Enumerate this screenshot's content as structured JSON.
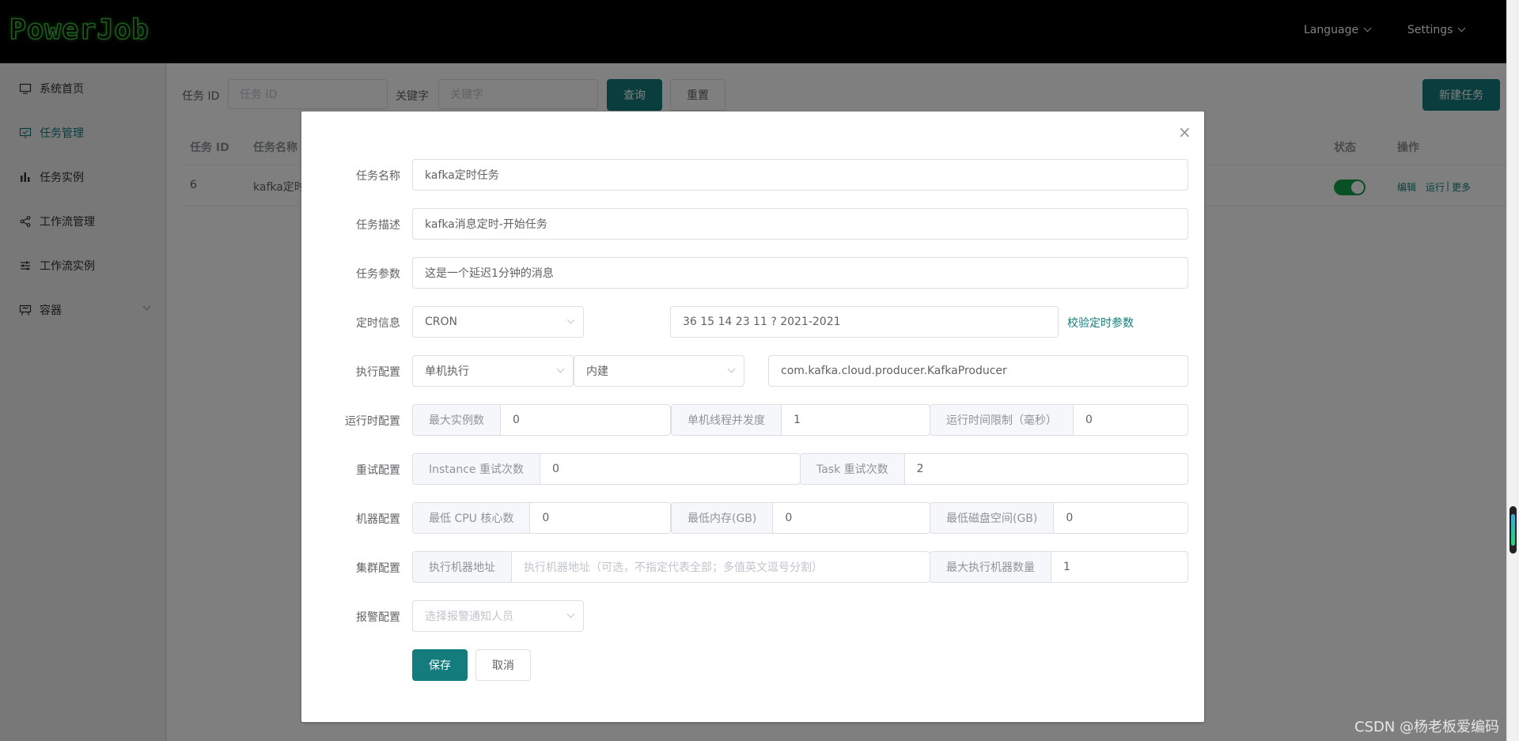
{
  "app": {
    "logo": "PowerJob",
    "menu_language": "Language",
    "menu_settings": "Settings"
  },
  "sidebar": {
    "items": [
      {
        "label": "系统首页",
        "icon": "monitor-icon"
      },
      {
        "label": "任务管理",
        "icon": "task-icon",
        "active": true
      },
      {
        "label": "任务实例",
        "icon": "bar-chart-icon"
      },
      {
        "label": "工作流管理",
        "icon": "share-icon"
      },
      {
        "label": "工作流实例",
        "icon": "sliders-icon"
      },
      {
        "label": "容器",
        "icon": "easel-icon",
        "expandable": true
      }
    ]
  },
  "search": {
    "id_label": "任务 ID",
    "id_placeholder": "任务 ID",
    "keyword_label": "关键字",
    "keyword_placeholder": "关键字",
    "query_button": "查询",
    "reset_button": "重置",
    "new_button": "新建任务"
  },
  "table": {
    "headers": {
      "id": "任务 ID",
      "name": "任务名称",
      "status": "状态",
      "ops": "操作"
    },
    "rows": [
      {
        "id": "6",
        "name": "kafka定时",
        "enabled": true,
        "op_edit": "编辑",
        "op_run": "运行",
        "op_sep": "|",
        "op_more": "更多"
      }
    ]
  },
  "dialog": {
    "close_icon": "×",
    "name_label": "任务名称",
    "name_value": "kafka定时任务",
    "desc_label": "任务描述",
    "desc_value": "kafka消息定时-开始任务",
    "params_label": "任务参数",
    "params_value": "这是一个延迟1分钟的消息",
    "timing_label": "定时信息",
    "timing_type": "CRON",
    "timing_expr": "36 15 14 23 11 ? 2021-2021",
    "validate_link": "校验定时参数",
    "exec_label": "执行配置",
    "exec_type": "单机执行",
    "processor_type": "内建",
    "processor_info": "com.kafka.cloud.producer.KafkaProducer",
    "runtime_label": "运行时配置",
    "max_instance_label": "最大实例数",
    "max_instance_value": "0",
    "thread_label": "单机线程并发度",
    "thread_value": "1",
    "time_limit_label": "运行时间限制（毫秒）",
    "time_limit_value": "0",
    "retry_label": "重试配置",
    "instance_retry_label": "Instance 重试次数",
    "instance_retry_value": "0",
    "task_retry_label": "Task 重试次数",
    "task_retry_value": "2",
    "machine_label": "机器配置",
    "cpu_label": "最低 CPU 核心数",
    "cpu_value": "0",
    "memory_label": "最低内存(GB)",
    "memory_value": "0",
    "disk_label": "最低磁盘空间(GB)",
    "disk_value": "0",
    "cluster_label": "集群配置",
    "designated_label": "执行机器地址",
    "designated_placeholder": "执行机器地址（可选，不指定代表全部；多值英文逗号分割）",
    "max_worker_label": "最大执行机器数量",
    "max_worker_value": "1",
    "alarm_label": "报警配置",
    "alarm_placeholder": "选择报警通知人员",
    "save_button": "保存",
    "cancel_button": "取消"
  },
  "watermark": "CSDN @杨老板爱编码"
}
